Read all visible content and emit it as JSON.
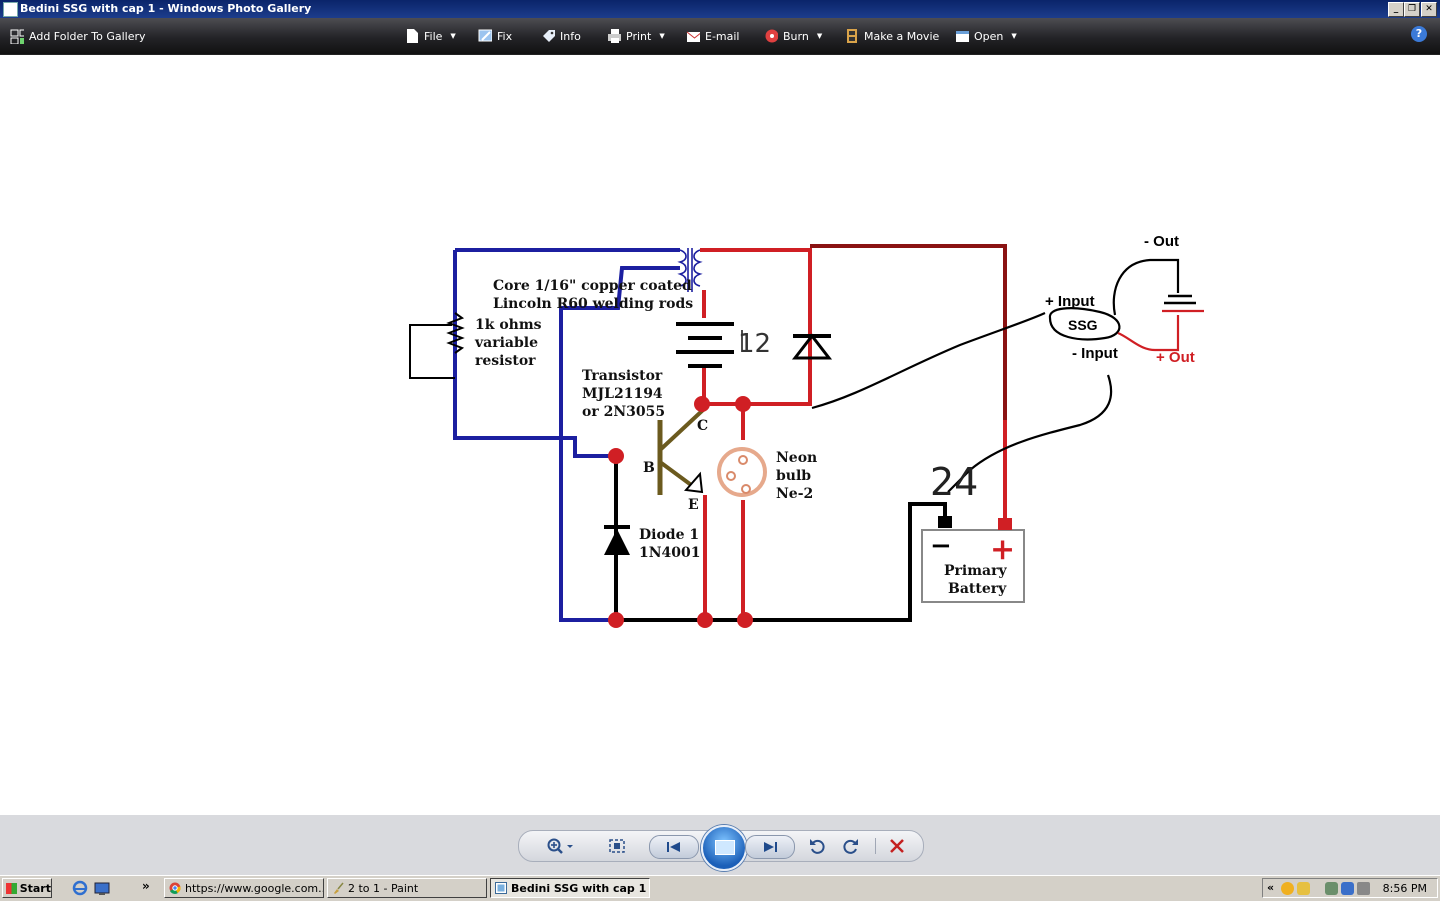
{
  "window": {
    "title": "Bedini SSG with cap 1 - Windows Photo Gallery",
    "buttons": [
      "_",
      "❐",
      "✕"
    ]
  },
  "toolbar": {
    "add_folder": "Add Folder To Gallery",
    "file": "File",
    "fix": "Fix",
    "info": "Info",
    "print": "Print",
    "email": "E-mail",
    "burn": "Burn",
    "make_movie": "Make a Movie",
    "open": "Open",
    "help": "?"
  },
  "image": {
    "core_line1": "Core 1/16\" copper coated",
    "core_line2": "Lincoln R60 welding rods",
    "resistor_line1": "1k ohms",
    "resistor_line2": "variable",
    "resistor_line3": "resistor",
    "transistor_line1": "Transistor",
    "transistor_line2": "MJL21194",
    "transistor_line3": "or 2N3055",
    "pin_c": "C",
    "pin_b": "B",
    "pin_e": "E",
    "neon_line1": "Neon",
    "neon_line2": "bulb",
    "neon_line3": "Ne-2",
    "diode_line1": "Diode 1",
    "diode_line2": "1N4001",
    "battery_line1": "Primary",
    "battery_line2": "Battery",
    "battery_minus": "−",
    "battery_plus": "+",
    "hand_12": "12",
    "hand_24": "24",
    "out_minus": "- Out",
    "input_plus": "+ Input",
    "ssg": "SSG",
    "input_minus": "- Input",
    "out_plus": "+ Out"
  },
  "controls": {
    "zoom": "zoom-in",
    "actual_size": "fit",
    "prev": "previous",
    "slideshow": "play-slideshow",
    "next": "next",
    "rotate_ccw": "rotate-left",
    "rotate_cw": "rotate-right",
    "delete": "delete"
  },
  "taskbar": {
    "start": "Start",
    "tasks": [
      "https://www.google.com...",
      "2 to 1 - Paint",
      "Bedini SSG with cap 1 ..."
    ],
    "tray_chevron": "«",
    "clock": "8:56 PM"
  },
  "colors": {
    "wire_blue": "#1c1fa0",
    "wire_red": "#d01f24",
    "wire_darkred": "#8a1212",
    "wire_black": "#000000"
  }
}
